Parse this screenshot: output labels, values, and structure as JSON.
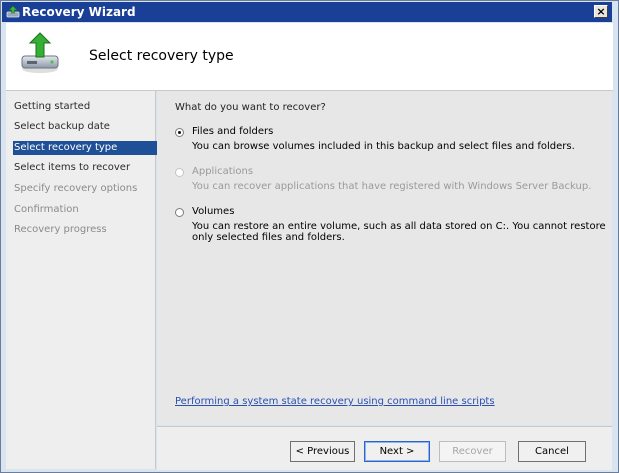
{
  "window": {
    "title": "Recovery Wizard",
    "close_label": "×"
  },
  "header": {
    "heading": "Select recovery type"
  },
  "steps": [
    {
      "label": "Getting started",
      "state": "done"
    },
    {
      "label": "Select backup date",
      "state": "done"
    },
    {
      "label": "Select recovery type",
      "state": "active"
    },
    {
      "label": "Select items to recover",
      "state": "done"
    },
    {
      "label": "Specify recovery options",
      "state": "future"
    },
    {
      "label": "Confirmation",
      "state": "future"
    },
    {
      "label": "Recovery progress",
      "state": "future"
    }
  ],
  "content": {
    "question": "What do you want to recover?",
    "options": [
      {
        "label": "Files and folders",
        "description": "You can browse volumes included in this backup and select files and folders.",
        "selected": true,
        "enabled": true
      },
      {
        "label": "Applications",
        "description": "You can recover applications that have registered with Windows Server Backup.",
        "selected": false,
        "enabled": false
      },
      {
        "label": "Volumes",
        "description": "You can restore an entire volume, such as all data stored on C:. You cannot restore only selected files and folders.",
        "selected": false,
        "enabled": true
      }
    ],
    "link": "Performing a system state recovery using command line scripts"
  },
  "buttons": {
    "previous": "< Previous",
    "next": "Next >",
    "recover": "Recover",
    "cancel": "Cancel"
  },
  "colors": {
    "titlebar": "#1a3f96",
    "active_step": "#1f4f96",
    "link": "#2a4fb5"
  }
}
